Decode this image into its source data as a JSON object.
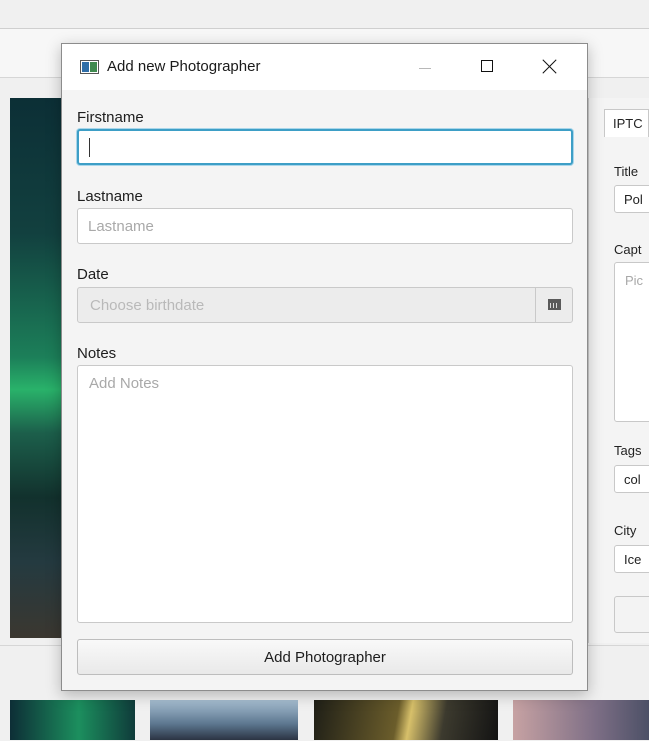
{
  "dialog": {
    "title": "Add new Photographer",
    "icon": "app-window-icon",
    "window_controls": [
      "minimize-icon",
      "maximize-icon",
      "close-icon"
    ],
    "accent_color": "#3d9ec6",
    "firstname": {
      "label": "Firstname",
      "value": "",
      "placeholder": ""
    },
    "lastname": {
      "label": "Lastname",
      "value": "",
      "placeholder": "Lastname"
    },
    "date": {
      "label": "Date",
      "placeholder": "Choose birthdate",
      "icon": "calendar-icon"
    },
    "notes": {
      "label": "Notes",
      "value": "",
      "placeholder": "Add Notes"
    },
    "submit_label": "Add Photographer"
  },
  "right_panel": {
    "tab": "IPTC",
    "title_label": "Title",
    "title_value": "Pol",
    "caption_label": "Capt",
    "caption_placeholder": "Pic",
    "tags_label": "Tags",
    "tags_value": "col",
    "city_label": "City",
    "city_value": "Ice"
  }
}
